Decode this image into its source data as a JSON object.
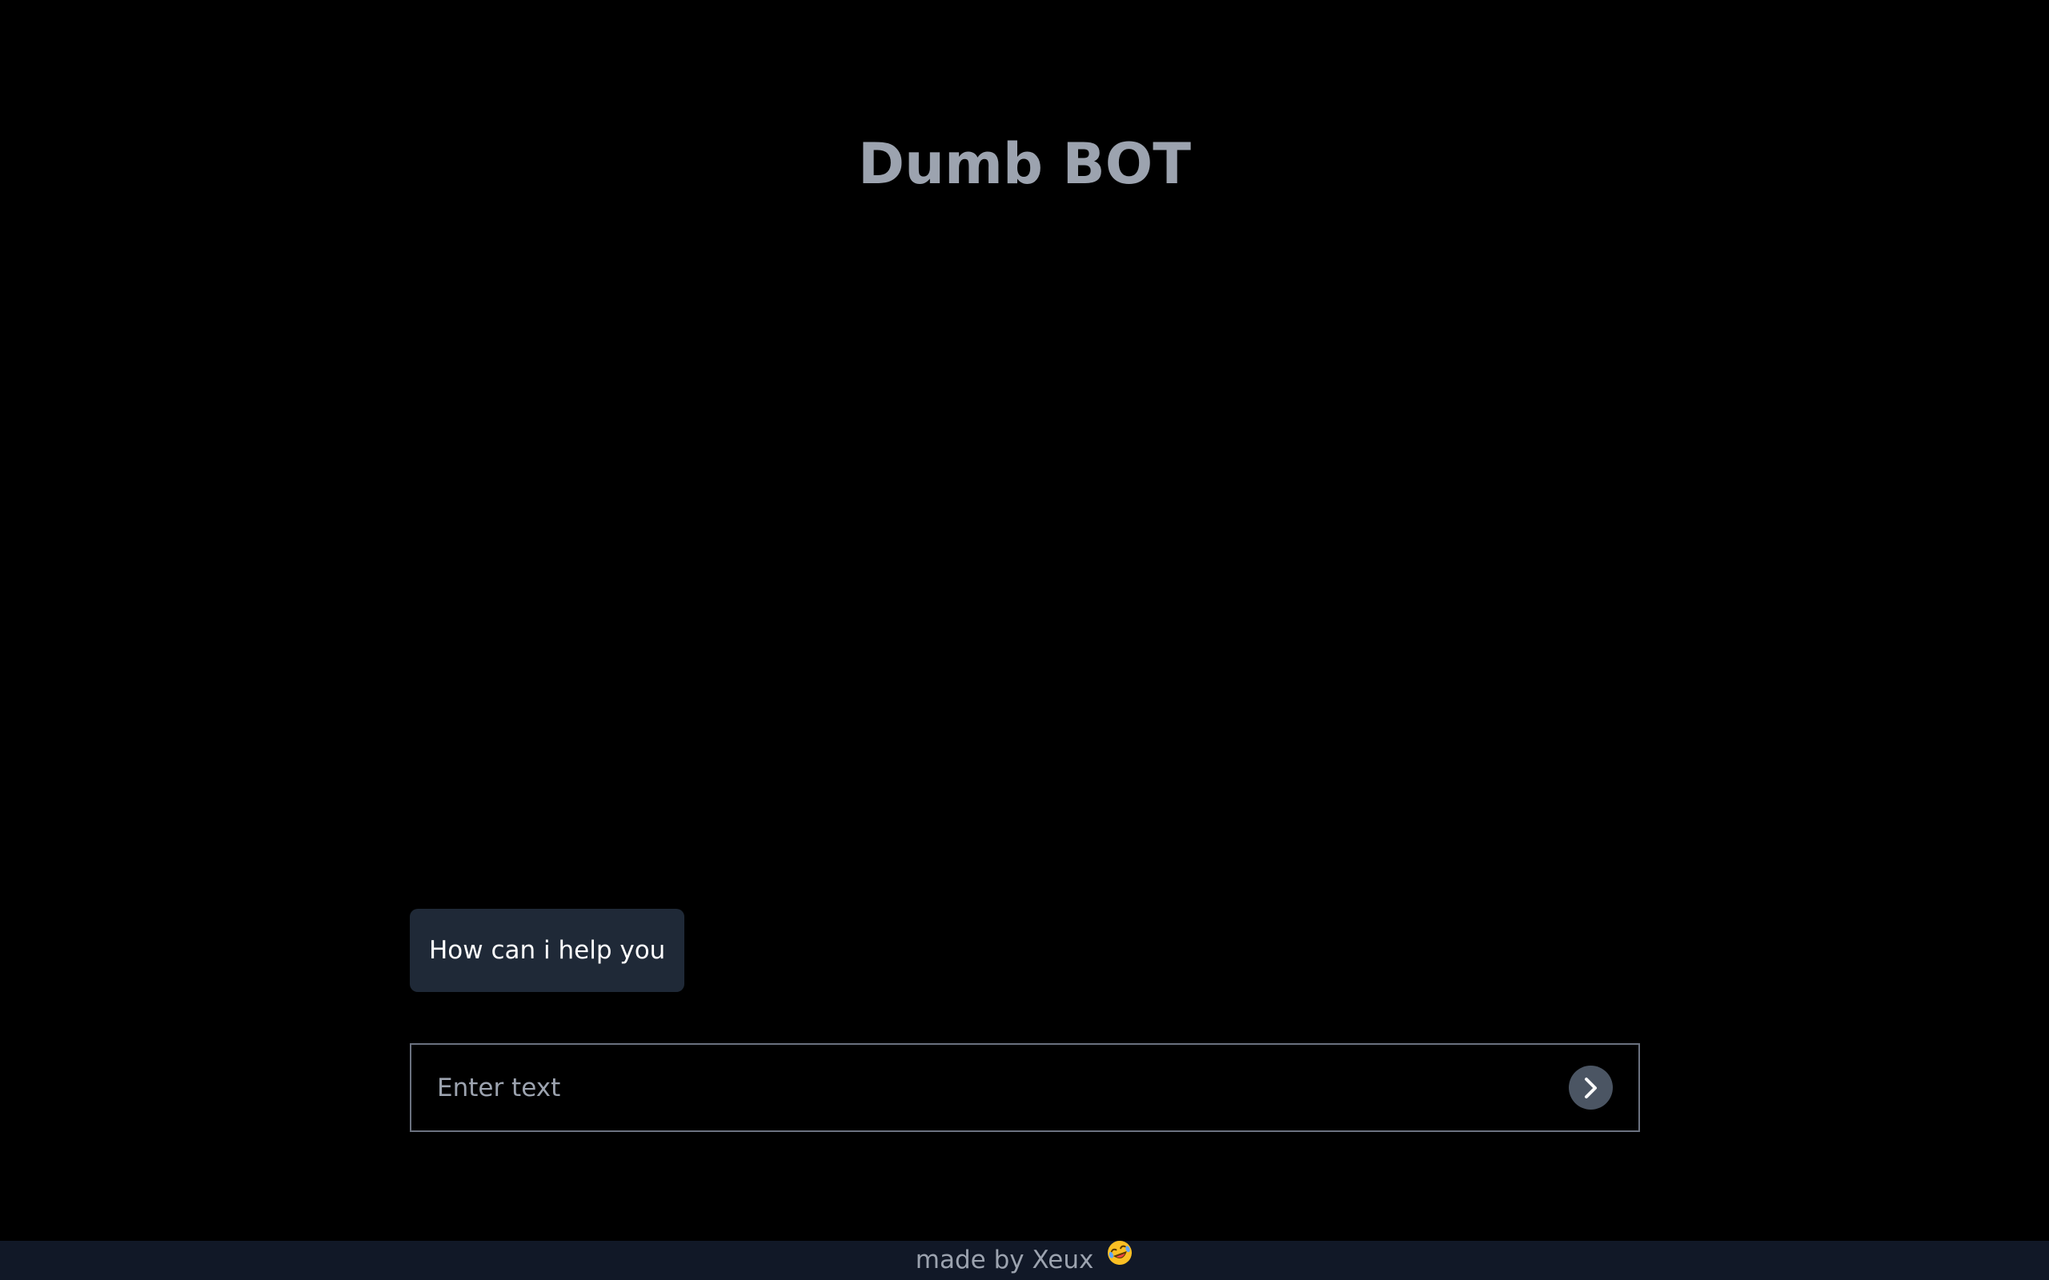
{
  "header": {
    "title": "Dumb BOT"
  },
  "chat": {
    "messages": [
      {
        "sender": "bot",
        "text": "How can i help you"
      }
    ]
  },
  "composer": {
    "placeholder": "Enter text",
    "value": "",
    "send_icon": "chevron-right-icon"
  },
  "footer": {
    "text": "made by Xeux",
    "emoji_icon": "rolling-on-floor-laughing-emoji"
  },
  "colors": {
    "background": "#000000",
    "title": "#9ca3af",
    "bubble": "#1f2937",
    "send_button": "#4b5563",
    "footer_bg": "#111827",
    "input_border": "#6b7280"
  }
}
